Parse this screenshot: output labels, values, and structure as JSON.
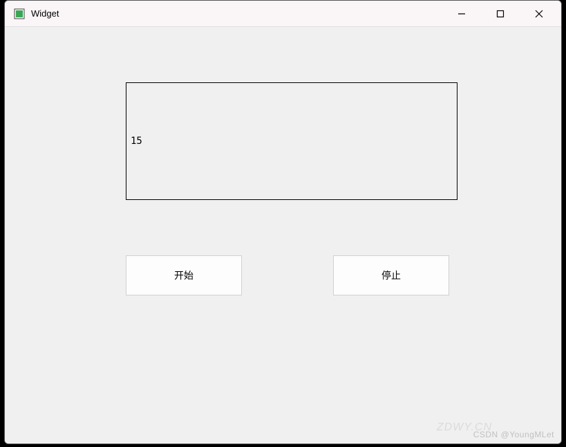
{
  "window": {
    "title": "Widget"
  },
  "display": {
    "value": "15"
  },
  "buttons": {
    "start_label": "开始",
    "stop_label": "停止"
  },
  "watermark": {
    "text1": "CSDN @YoungMLet",
    "text2": "ZDWY.CN"
  }
}
